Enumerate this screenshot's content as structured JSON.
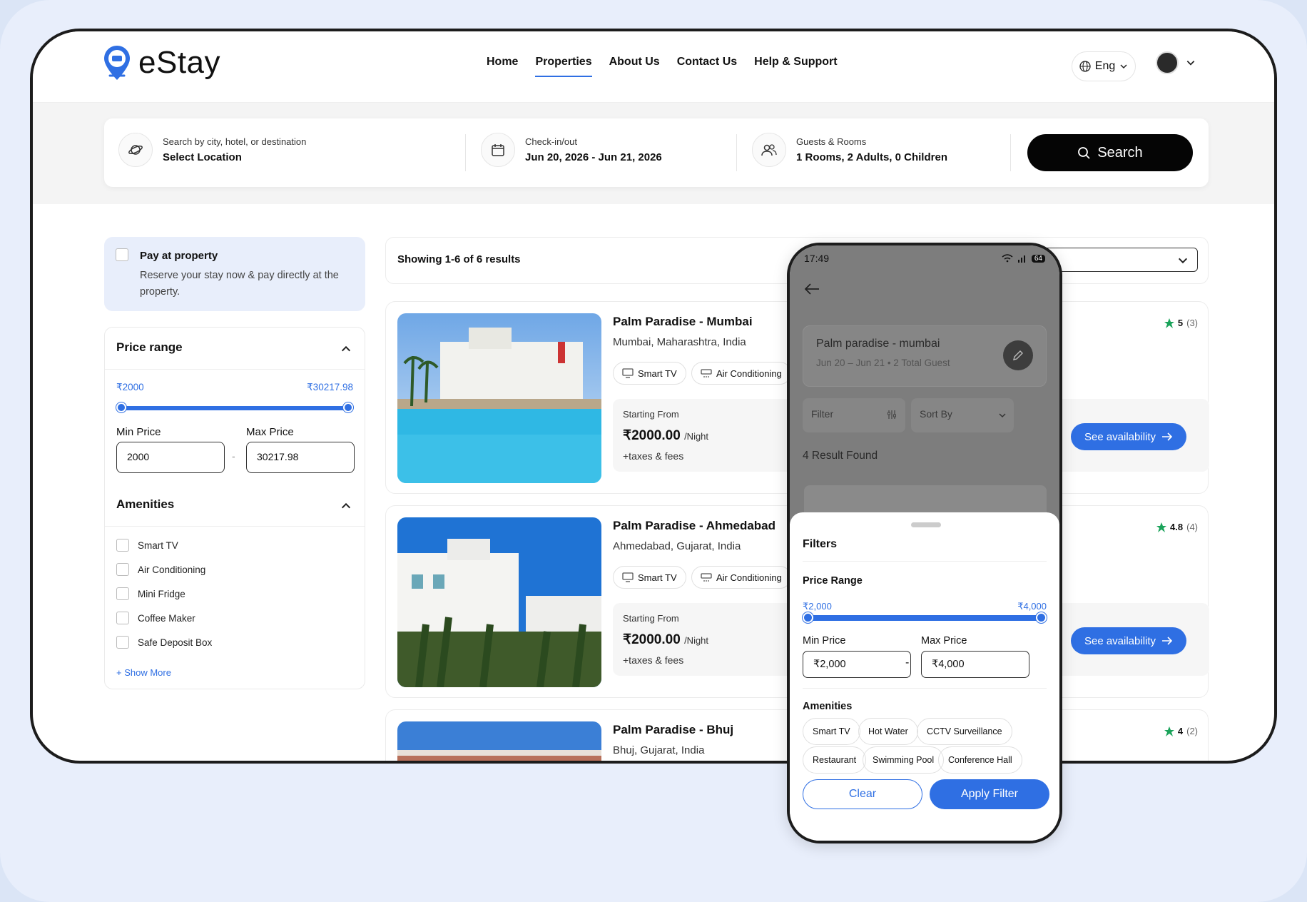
{
  "brand": {
    "name": "eStay",
    "accent": "#2f6fe3"
  },
  "nav": {
    "items": [
      {
        "label": "Home"
      },
      {
        "label": "Properties",
        "active": true
      },
      {
        "label": "About Us"
      },
      {
        "label": "Contact Us"
      },
      {
        "label": "Help & Support"
      }
    ]
  },
  "lang": {
    "label": "Eng"
  },
  "search": {
    "location_label": "Search by city, hotel, or destination",
    "location_value": "Select Location",
    "dates_label": "Check-in/out",
    "dates_value": "Jun 20, 2026 - Jun 21, 2026",
    "guests_label": "Guests & Rooms",
    "guests_value": "1 Rooms, 2 Adults, 0 Children",
    "button": "Search"
  },
  "sidebar": {
    "pay": {
      "title": "Pay at property",
      "desc": "Reserve your stay now & pay directly at the property."
    },
    "price": {
      "title": "Price range",
      "min_display": "₹2000",
      "max_display": "₹30217.98",
      "min_label": "Min Price",
      "max_label": "Max Price",
      "min_value": "2000",
      "max_value": "30217.98",
      "dash": "-"
    },
    "amenities": {
      "title": "Amenities",
      "items": [
        "Smart TV",
        "Air Conditioning",
        "Mini Fridge",
        "Coffee Maker",
        "Safe Deposit Box"
      ],
      "show_more": "+ Show More"
    }
  },
  "results": {
    "summary": "Showing 1-6 of 6 results",
    "cards": [
      {
        "name": "Palm Paradise - Mumbai",
        "location": "Mumbai, Maharashtra, India",
        "tags": [
          "Smart TV",
          "Air Conditioning"
        ],
        "from": "Starting From",
        "price": "₹2000.00",
        "per": "/Night",
        "taxes": "+taxes & fees",
        "cta": "See availability",
        "rating": "5",
        "reviews": "(3)"
      },
      {
        "name": "Palm Paradise - Ahmedabad",
        "location": "Ahmedabad, Gujarat, India",
        "tags": [
          "Smart TV",
          "Air Conditioning"
        ],
        "from": "Starting From",
        "price": "₹2000.00",
        "per": "/Night",
        "taxes": "+taxes & fees",
        "cta": "See availability",
        "rating": "4.8",
        "reviews": "(4)"
      },
      {
        "name": "Palm Paradise - Bhuj",
        "location": "Bhuj, Gujarat, India",
        "rating": "4",
        "reviews": "(2)"
      }
    ]
  },
  "phone": {
    "time": "17:49",
    "battery": "64",
    "search_title": "Palm paradise - mumbai",
    "search_sub": "Jun 20 – Jun 21  •  2 Total Guest",
    "filter_label": "Filter",
    "sort_label": "Sort By",
    "result_count": "4 Result Found",
    "sheet": {
      "title": "Filters",
      "price_title": "Price Range",
      "min_display": "₹2,000",
      "max_display": "₹4,000",
      "min_label": "Min Price",
      "max_label": "Max Price",
      "min_value": "₹2,000",
      "max_value": "₹4,000",
      "dash": "-",
      "amenities_title": "Amenities",
      "chips": [
        "Smart TV",
        "Hot Water",
        "CCTV Surveillance",
        "Restaurant",
        "Swimming Pool",
        "Conference Hall"
      ],
      "clear": "Clear",
      "apply": "Apply Filter"
    }
  }
}
